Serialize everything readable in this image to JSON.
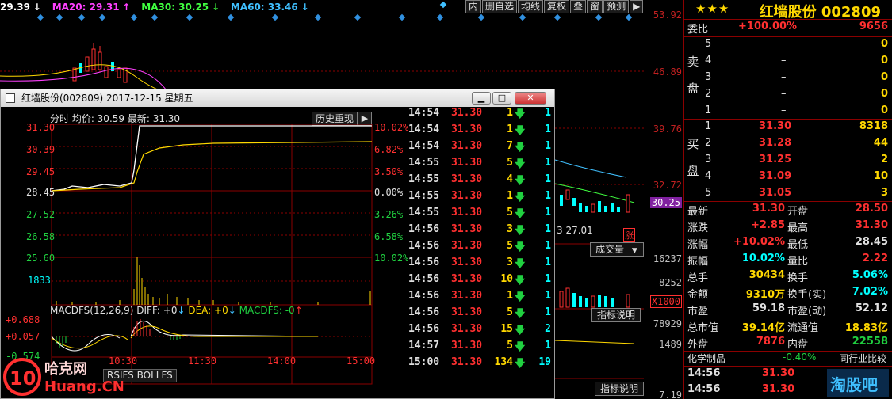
{
  "ma": [
    {
      "label": "29.39",
      "arrow": "↓",
      "color": "#ffffff"
    },
    {
      "label": "MA20: 29.31",
      "arrow": "↑",
      "color": "#ff40ff"
    },
    {
      "label": "MA30: 30.25",
      "arrow": "↓",
      "color": "#40ff40"
    },
    {
      "label": "MA60: 33.46",
      "arrow": "↓",
      "color": "#40c0ff"
    }
  ],
  "toolbar": [
    "内",
    "删自选",
    "均线",
    "复权",
    "叠",
    "窗",
    "预测",
    "▶"
  ],
  "main_price_axis": [
    "53.92",
    "46.89",
    "39.76",
    "32.72",
    "30.25",
    "16237",
    "8252",
    "X1000",
    "78929",
    "1489",
    "7.19"
  ],
  "main_date_label": "3 27.01",
  "main_badge": "涨",
  "volume_dropdown": "成交量",
  "indicator_btn_1": "指标说明",
  "indicator_btn_2": "指标说明",
  "main_bottom_tabs": "RSIFS BOLLFS",
  "popup": {
    "title": "红墙股份(002809) 2017-12-15 星期五",
    "header": "分时  均价: 30.59  最新: 31.30",
    "history_btn": "历史重现",
    "left_axis": [
      "31.30",
      "30.39",
      "29.45",
      "28.45",
      "27.52",
      "26.58",
      "25.60",
      "1833"
    ],
    "right_axis": [
      "10.02%",
      "6.82%",
      "3.50%",
      "0.00%",
      "3.26%",
      "6.58%",
      "10.02%"
    ],
    "macd_label": "MACDFS(12,26,9) DIFF: +0",
    "macd_dea": "DEA: +0",
    "macd_macdfs": "MACDFS: -0",
    "macd_axis": [
      "+0.688",
      "+0.057",
      "-0.574"
    ],
    "time_axis": [
      "10:30",
      "11:30",
      "14:00",
      "15:00"
    ],
    "trades": [
      {
        "time": "14:54",
        "price": "31.30",
        "vol": "1",
        "num": "1"
      },
      {
        "time": "14:54",
        "price": "31.30",
        "vol": "1",
        "num": "1"
      },
      {
        "time": "14:54",
        "price": "31.30",
        "vol": "7",
        "num": "1"
      },
      {
        "time": "14:55",
        "price": "31.30",
        "vol": "5",
        "num": "1"
      },
      {
        "time": "14:55",
        "price": "31.30",
        "vol": "4",
        "num": "1"
      },
      {
        "time": "14:55",
        "price": "31.30",
        "vol": "1",
        "num": "1"
      },
      {
        "time": "14:55",
        "price": "31.30",
        "vol": "5",
        "num": "1"
      },
      {
        "time": "14:56",
        "price": "31.30",
        "vol": "3",
        "num": "1"
      },
      {
        "time": "14:56",
        "price": "31.30",
        "vol": "5",
        "num": "1"
      },
      {
        "time": "14:56",
        "price": "31.30",
        "vol": "3",
        "num": "1"
      },
      {
        "time": "14:56",
        "price": "31.30",
        "vol": "10",
        "num": "1"
      },
      {
        "time": "14:56",
        "price": "31.30",
        "vol": "1",
        "num": "1"
      },
      {
        "time": "14:56",
        "price": "31.30",
        "vol": "5",
        "num": "1"
      },
      {
        "time": "14:56",
        "price": "31.30",
        "vol": "15",
        "num": "2"
      },
      {
        "time": "14:57",
        "price": "31.30",
        "vol": "5",
        "num": "1"
      },
      {
        "time": "15:00",
        "price": "31.30",
        "vol": "134",
        "num": "19"
      }
    ]
  },
  "quote": {
    "stars": "★★★",
    "name": "红墙股份 002809",
    "weibi_label": "委比",
    "weibi_value": "+100.00%",
    "weibi_diff": "9656",
    "sell_label_1": "卖",
    "sell_label_2": "盘",
    "buy_label_1": "买",
    "buy_label_2": "盘",
    "sell": [
      {
        "lvl": "5",
        "price": "–",
        "vol": "0"
      },
      {
        "lvl": "4",
        "price": "–",
        "vol": "0"
      },
      {
        "lvl": "3",
        "price": "–",
        "vol": "0"
      },
      {
        "lvl": "2",
        "price": "–",
        "vol": "0"
      },
      {
        "lvl": "1",
        "price": "–",
        "vol": "0"
      }
    ],
    "buy": [
      {
        "lvl": "1",
        "price": "31.30",
        "vol": "8318"
      },
      {
        "lvl": "2",
        "price": "31.28",
        "vol": "44"
      },
      {
        "lvl": "3",
        "price": "31.25",
        "vol": "2"
      },
      {
        "lvl": "4",
        "price": "31.09",
        "vol": "10"
      },
      {
        "lvl": "5",
        "price": "31.05",
        "vol": "3"
      }
    ],
    "stats": [
      {
        "l1": "最新",
        "v1": "31.30",
        "c1": "red",
        "l2": "开盘",
        "v2": "28.50",
        "c2": "red"
      },
      {
        "l1": "涨跌",
        "v1": "+2.85",
        "c1": "red",
        "l2": "最高",
        "v2": "31.30",
        "c2": "red"
      },
      {
        "l1": "涨幅",
        "v1": "+10.02%",
        "c1": "red",
        "l2": "最低",
        "v2": "28.45",
        "c2": "wht"
      },
      {
        "l1": "振幅",
        "v1": "10.02%",
        "c1": "cyn",
        "l2": "量比",
        "v2": "2.22",
        "c2": "red"
      },
      {
        "l1": "总手",
        "v1": "30434",
        "c1": "yel",
        "l2": "换手",
        "v2": "5.06%",
        "c2": "cyn"
      },
      {
        "l1": "金额",
        "v1": "9310万",
        "c1": "yel",
        "l2": "换手(实)",
        "v2": "7.02%",
        "c2": "cyn"
      },
      {
        "l1": "市盈",
        "v1": "59.18",
        "c1": "wht",
        "l2": "市盈(动)",
        "v2": "52.12",
        "c2": "wht"
      },
      {
        "l1": "总市值",
        "v1": "39.14亿",
        "c1": "yel",
        "l2": "流通值",
        "v2": "18.83亿",
        "c2": "yel"
      },
      {
        "l1": "外盘",
        "v1": "7876",
        "c1": "red",
        "l2": "内盘",
        "v2": "22558",
        "c2": "grn"
      }
    ],
    "sector": "化学制品",
    "sector_chg": "-0.40%",
    "sector_btn": "同行业比较",
    "bottom_trades": [
      {
        "time": "14:56",
        "price": "31.30"
      },
      {
        "time": "14:56",
        "price": "31.30"
      }
    ]
  },
  "watermark": "10 哈克网 Huang.CN"
}
